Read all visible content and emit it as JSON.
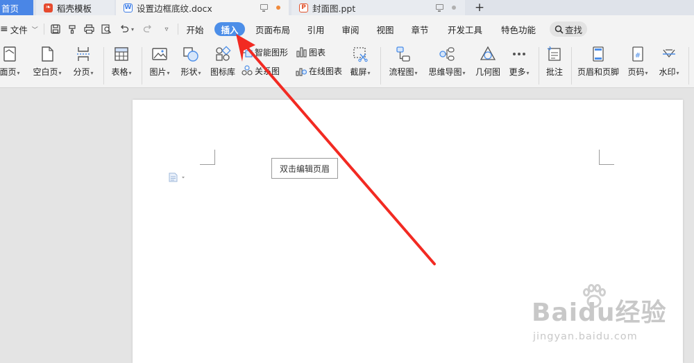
{
  "tabs": {
    "home": "首页",
    "docer": "稻壳模板",
    "doc": "设置边框底纹.docx",
    "ppt": "封面图.ppt",
    "add": "+"
  },
  "menu": {
    "file": "文件",
    "tabs": [
      "开始",
      "插入",
      "页面布局",
      "引用",
      "审阅",
      "视图",
      "章节",
      "开发工具",
      "特色功能"
    ],
    "active_tab": "插入",
    "search": "查找"
  },
  "ribbon": {
    "cover_page": "面页",
    "blank_page": "空白页",
    "page_break": "分页",
    "table": "表格",
    "picture": "图片",
    "shape": "形状",
    "icon_lib": "图标库",
    "smart_art": "智能图形",
    "chart": "图表",
    "relation_chart": "关系图",
    "online_chart": "在线图表",
    "screenshot": "截屏",
    "flowchart": "流程图",
    "mindmap": "思维导图",
    "geometry": "几何图",
    "more": "更多",
    "comment": "批注",
    "header_footer": "页眉和页脚",
    "page_number": "页码",
    "watermark": "水印"
  },
  "document": {
    "header_hint": "双击编辑页眉"
  },
  "watermark_logo": {
    "main": "Baidu经验",
    "sub": "jingyan.baidu.com"
  },
  "colors": {
    "accent": "#4c8ee8",
    "arrow": "#f22a22"
  }
}
